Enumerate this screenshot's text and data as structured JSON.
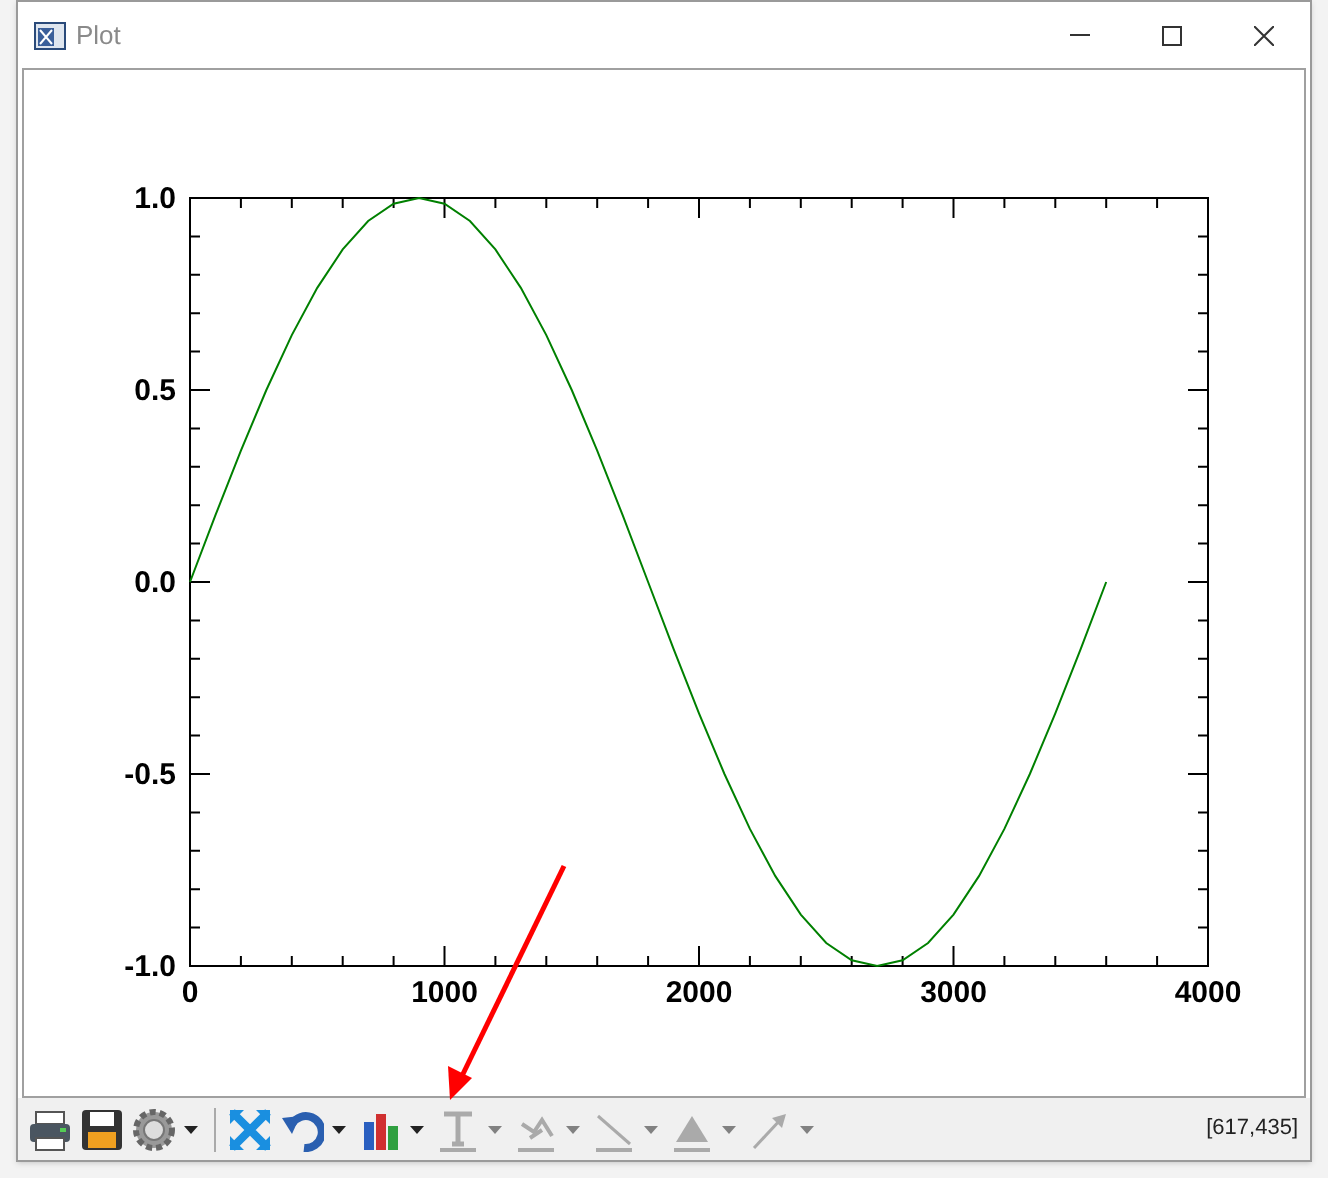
{
  "window": {
    "title": "Plot"
  },
  "plot": {
    "chart_data": {
      "type": "line",
      "x": [
        0,
        100,
        200,
        300,
        400,
        500,
        600,
        700,
        800,
        900,
        1000,
        1100,
        1200,
        1300,
        1400,
        1500,
        1600,
        1700,
        1800,
        1900,
        2000,
        2100,
        2200,
        2300,
        2400,
        2500,
        2600,
        2700,
        2800,
        2900,
        3000,
        3100,
        3200,
        3300,
        3400,
        3500,
        3600
      ],
      "series": [
        {
          "color": "#008000",
          "values": [
            0,
            0.174,
            0.342,
            0.5,
            0.643,
            0.766,
            0.866,
            0.94,
            0.985,
            1,
            0.985,
            0.94,
            0.866,
            0.766,
            0.643,
            0.5,
            0.342,
            0.174,
            0,
            -0.174,
            -0.342,
            -0.5,
            -0.643,
            -0.766,
            -0.866,
            -0.94,
            -0.985,
            -1,
            -0.985,
            -0.94,
            -0.866,
            -0.766,
            -0.643,
            -0.5,
            -0.342,
            -0.174,
            0
          ]
        }
      ],
      "xlim": [
        0,
        4000
      ],
      "ylim": [
        -1,
        1
      ],
      "xticks": [
        0,
        1000,
        2000,
        3000,
        4000
      ],
      "yticks": [
        {
          "value": -1,
          "label": "-1.0"
        },
        {
          "value": -0.5,
          "label": "-0.5"
        },
        {
          "value": 0,
          "label": "0.0"
        },
        {
          "value": 0.5,
          "label": "0.5"
        },
        {
          "value": 1,
          "label": "1.0"
        }
      ]
    }
  },
  "toolbar": {
    "buttons": [
      {
        "kind": "print",
        "disabled": false,
        "dropdown": false
      },
      {
        "kind": "save",
        "disabled": false,
        "dropdown": false
      },
      {
        "kind": "settings",
        "disabled": false,
        "dropdown": true
      },
      {
        "kind": "separator"
      },
      {
        "kind": "fit",
        "disabled": false,
        "dropdown": false
      },
      {
        "kind": "undo",
        "disabled": false,
        "dropdown": true
      },
      {
        "kind": "chart",
        "disabled": false,
        "dropdown": true
      },
      {
        "kind": "text",
        "disabled": true,
        "dropdown": true
      },
      {
        "kind": "symbol",
        "disabled": true,
        "dropdown": true
      },
      {
        "kind": "line",
        "disabled": true,
        "dropdown": true
      },
      {
        "kind": "fill",
        "disabled": true,
        "dropdown": true
      },
      {
        "kind": "arrow",
        "disabled": true,
        "dropdown": true
      }
    ],
    "coordinates": "[617,435]"
  }
}
